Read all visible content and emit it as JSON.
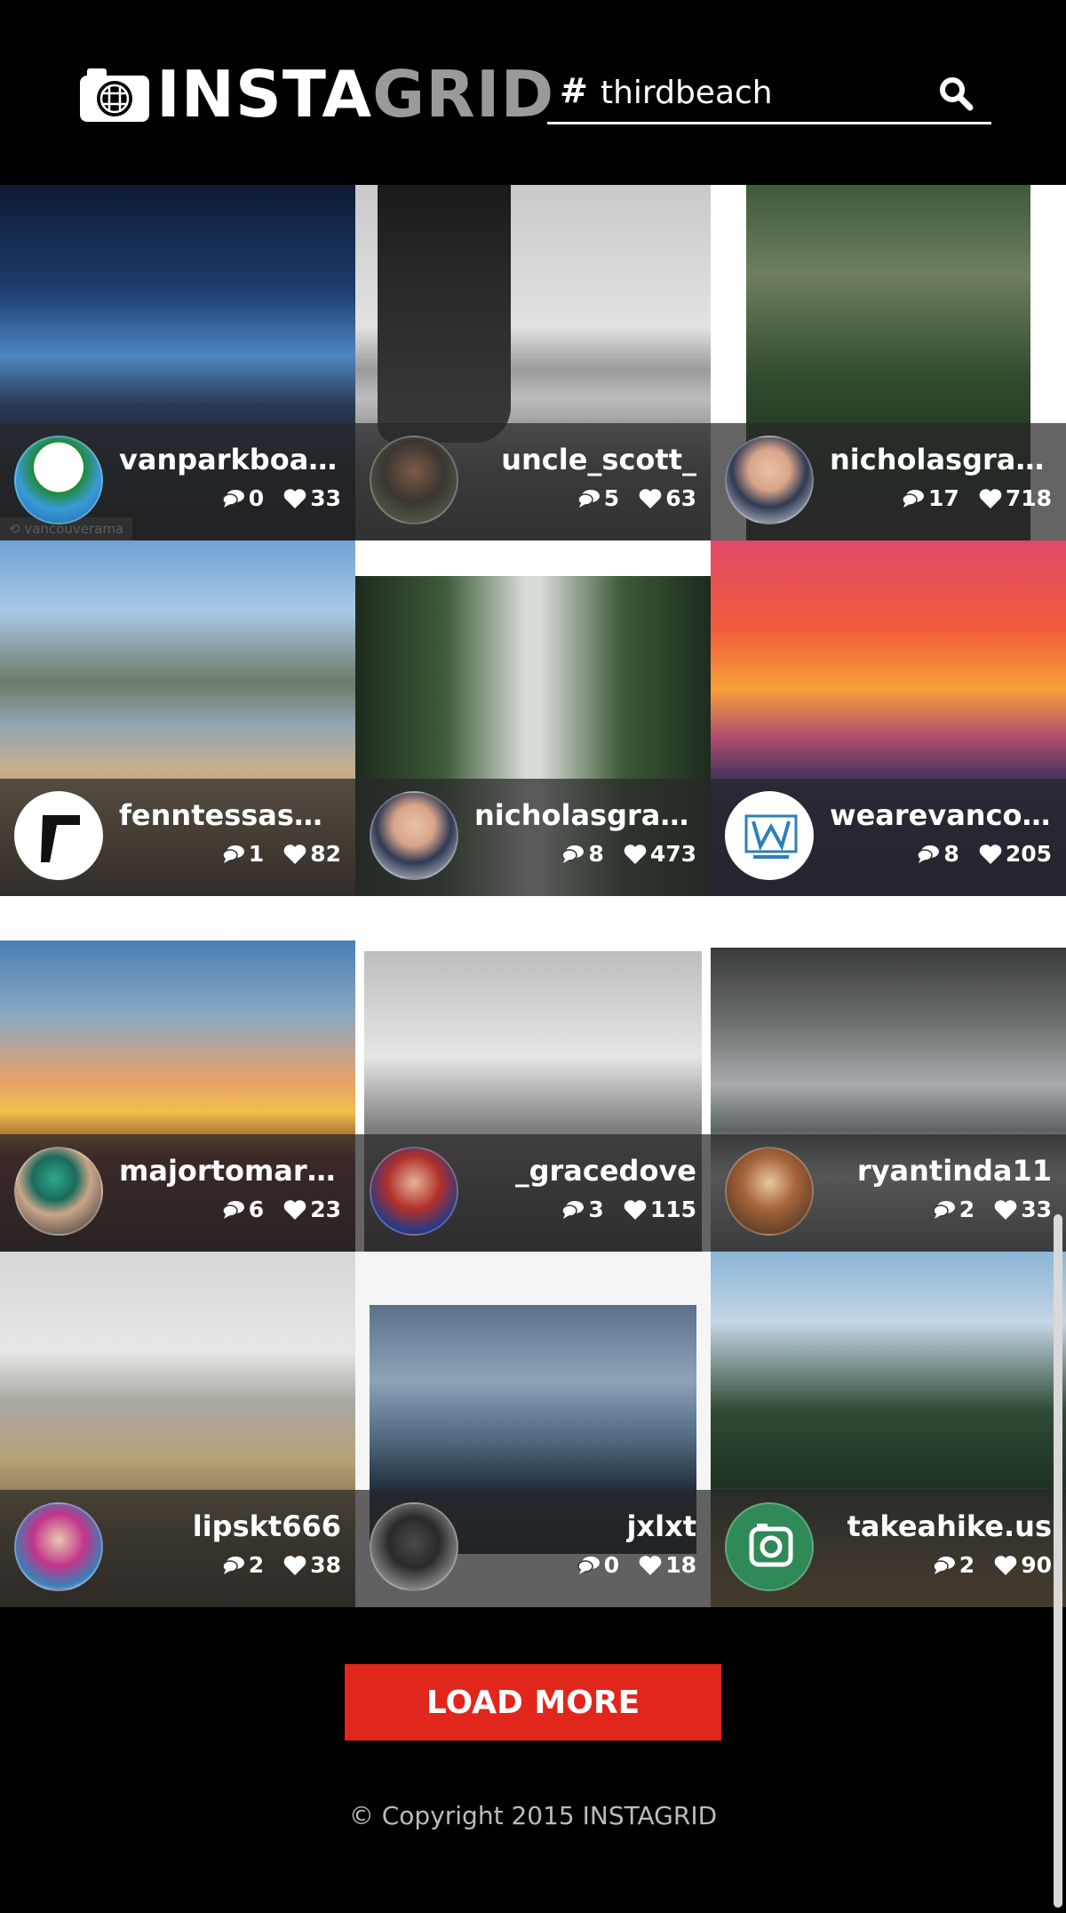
{
  "header": {
    "logo_insta": "INSTA",
    "logo_grid": "GRID",
    "search_prefix": "#",
    "search_value": "thirdbeach"
  },
  "posts": [
    {
      "username": "vanparkboard",
      "comments": "0",
      "likes": "33"
    },
    {
      "username": "uncle_scott_",
      "comments": "5",
      "likes": "63"
    },
    {
      "username": "nicholasgraves",
      "comments": "17",
      "likes": "718"
    },
    {
      "username": "fenntessaswi...",
      "comments": "1",
      "likes": "82"
    },
    {
      "username": "nicholasgraves",
      "comments": "8",
      "likes": "473"
    },
    {
      "username": "wearevancou...",
      "comments": "8",
      "likes": "205"
    },
    {
      "username": "majortomard...",
      "comments": "6",
      "likes": "23"
    },
    {
      "username": "_gracedove",
      "comments": "3",
      "likes": "115"
    },
    {
      "username": "ryantinda11",
      "comments": "2",
      "likes": "33"
    },
    {
      "username": "lipskt666",
      "comments": "2",
      "likes": "38"
    },
    {
      "username": "jxlxt",
      "comments": "0",
      "likes": "18"
    },
    {
      "username": "takeahike.us",
      "comments": "2",
      "likes": "90"
    }
  ],
  "overlay_credit": "vancouverama",
  "footer": {
    "load_more_label": "LOAD MORE",
    "copyright": "© Copyright 2015 INSTAGRID"
  },
  "colors": {
    "accent": "#e1261c",
    "background": "#000000",
    "logo_grey": "#9a9a9a"
  }
}
